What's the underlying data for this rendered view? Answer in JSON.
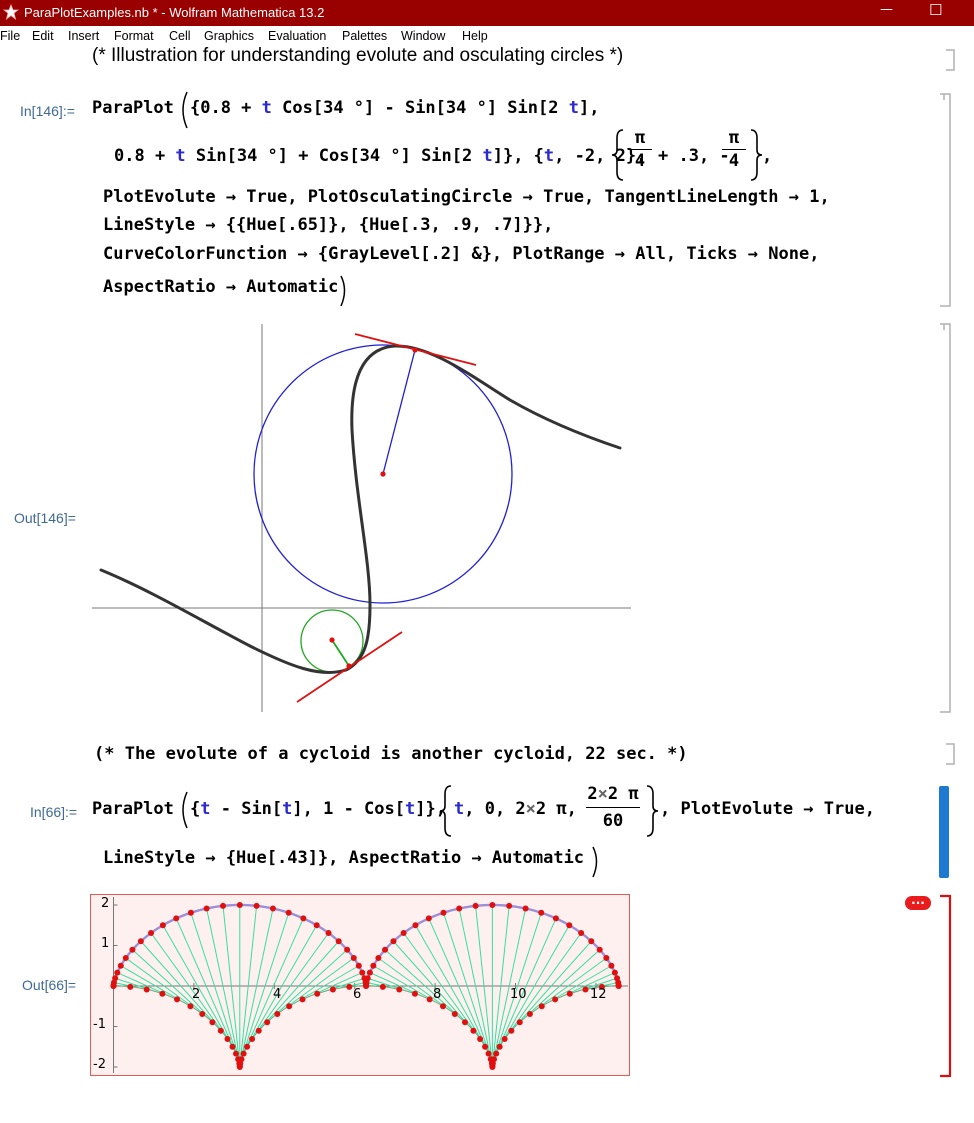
{
  "window": {
    "title": "ParaPlotExamples.nb * - Wolfram Mathematica 13.2",
    "minimize": "—",
    "maximize": "☐"
  },
  "menu": [
    "File",
    "Edit",
    "Insert",
    "Format",
    "Cell",
    "Graphics",
    "Evaluation",
    "Palettes",
    "Window",
    "Help"
  ],
  "comment1": "(* Illustration for understanding evolute and osculating circles *)",
  "in146": {
    "label": "In[146]:=",
    "line1a": "ParaPlot",
    "line1b": "{0.8 + ",
    "line1c": "t",
    "line1d": " Cos[34 °] - Sin[34 °] Sin[2 ",
    "line1e": "t",
    "line1f": "],",
    "line2a": "0.8 + ",
    "line2b": "t",
    "line2c": " Sin[34 °] + Cos[34 °] Sin[2 ",
    "line2d": "t",
    "line2e": "]}, {",
    "line2f": "t",
    "line2g": ", -2, 2},",
    "frac1_num": "π",
    "frac1_den": "4",
    "mid": "+ .3, -",
    "frac2_num": "π",
    "frac2_den": "4",
    "line2tail": ",",
    "line3": "PlotEvolute → True, PlotOsculatingCircle → True, TangentLineLength → 1,",
    "line4": "LineStyle → {{Hue[.65]}, {Hue[.3, .9, .7]}},",
    "line5": "CurveColorFunction → {GrayLevel[.2] &}, PlotRange → All, Ticks → None,",
    "line6": "AspectRatio → Automatic"
  },
  "out146": {
    "label": "Out[146]="
  },
  "comment2": "(* The evolute of a cycloid is another cycloid, 22 sec. *)",
  "in66": {
    "label": "In[66]:=",
    "a": "ParaPlot",
    "b": "{",
    "c": "t",
    "d": " - Sin[",
    "e": "t",
    "f": "], 1 - Cos[",
    "g": "t",
    "h": "]},",
    "i": "t",
    "j": ", 0, 2",
    "k": "×",
    "l": "2 π,",
    "frac_num_a": "2",
    "frac_num_b": "×",
    "frac_num_c": "2 π",
    "frac_den": "60",
    "tail": ", PlotEvolute → True,",
    "line2": "LineStyle → {Hue[.43]}, AspectRatio → Automatic"
  },
  "out66": {
    "label": "Out[66]=",
    "xticks": [
      "2",
      "4",
      "6",
      "8",
      "10",
      "12"
    ],
    "yticks": [
      "2",
      "1",
      "-1",
      "-2"
    ]
  },
  "colors": {
    "titlebar": "#990000",
    "label": "#3f6a93",
    "circle_large": "#1f1fd6",
    "circle_small": "#20a820",
    "tangent": "#e01010",
    "curve": "#333333",
    "evolute_lines": "#33e0a0",
    "cycloid_bg": "#fff0f0",
    "error_bracket": "#d81010",
    "selected_bracket": "#1e7ad0"
  }
}
